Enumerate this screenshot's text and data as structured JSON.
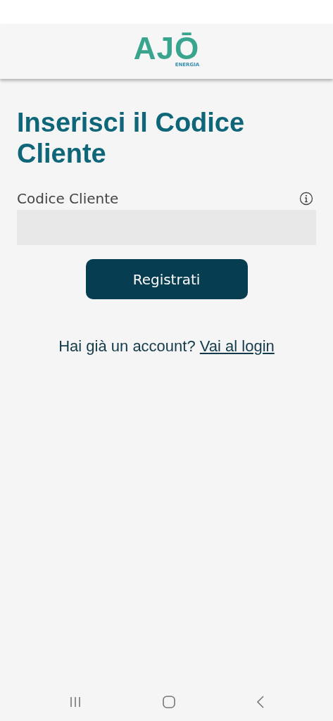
{
  "header": {
    "logo": {
      "mark": "AJŌ",
      "subtitle": "ENERGIA"
    }
  },
  "title": "Inserisci il Codice Cliente",
  "field": {
    "label": "Codice Cliente"
  },
  "button": "Registrati",
  "footer": {
    "text": "Hai già un account?",
    "link": "Vai al login"
  }
}
